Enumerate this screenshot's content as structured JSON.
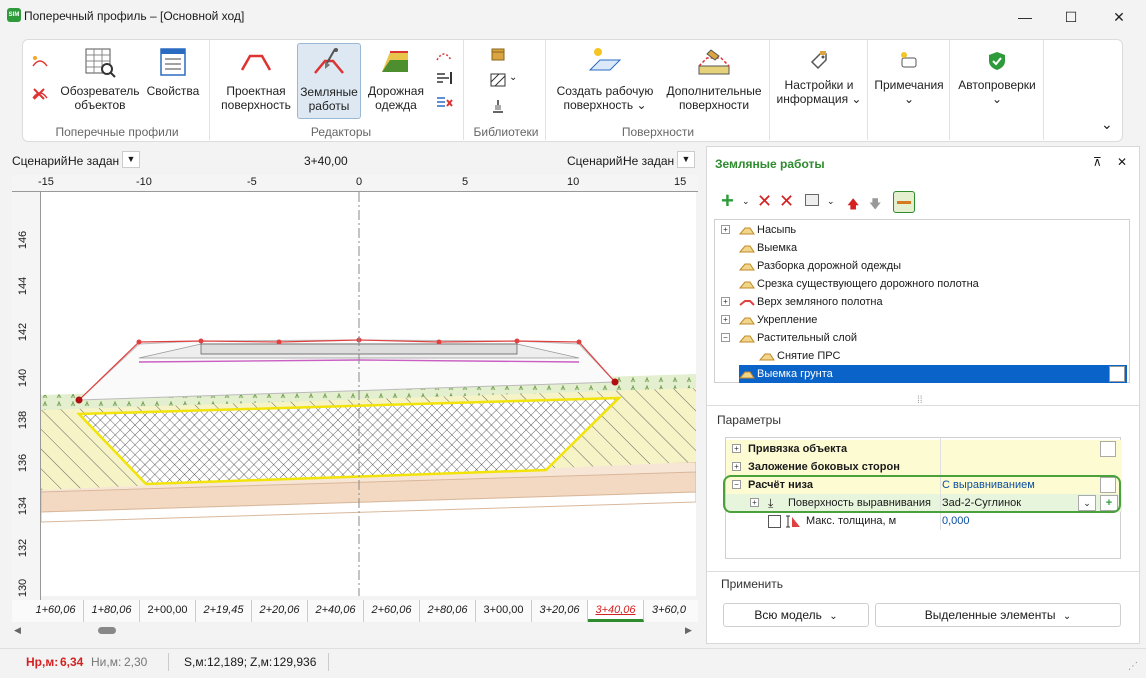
{
  "window": {
    "title": "Поперечный профиль – [Основной ход]",
    "app_icon_text": "SIM",
    "minimize": "—",
    "maximize": "☐",
    "close": "✕"
  },
  "ribbon": {
    "groups": {
      "cross_profiles": "Поперечные профили",
      "editors": "Редакторы",
      "libraries": "Библиотеки",
      "surfaces": "Поверхности"
    },
    "buttons": {
      "browser": "Обозреватель\nобъектов",
      "properties": "Свойства",
      "design_surface": "Проектная\nповерхность",
      "earthworks": "Земляные\nработы",
      "pavement": "Дорожная\nодежда",
      "create_work_surface": "Создать рабочую\nповерхность ⌄",
      "additional_surfaces": "Дополнительные\nповерхности",
      "settings_info": "Настройки и\nинформация ⌄",
      "notes": "Примечания\n⌄",
      "autochecks": "Автопроверки\n⌄"
    },
    "collapse": "⌄"
  },
  "view": {
    "scenario_left_label": "Сценарий:",
    "scenario_left_value": "Не задан",
    "station_center": "3+40,00",
    "scenario_right_label": "Сценарий:",
    "scenario_right_value": "Не задан",
    "x_ticks": [
      "-15",
      "-10",
      "-5",
      "0",
      "5",
      "10",
      "15"
    ],
    "y_ticks": [
      "146",
      "144",
      "142",
      "140",
      "138",
      "136",
      "134",
      "132",
      "130"
    ],
    "stations": [
      "1+60,06",
      "1+80,06",
      "2+00,00",
      "2+19,45",
      "2+20,06",
      "2+40,06",
      "2+60,06",
      "2+80,06",
      "3+00,00",
      "3+20,06",
      "3+40,06",
      "3+60,0"
    ],
    "active_station": "3+40,06"
  },
  "status": {
    "hr_label": "Нр,м:",
    "hr_value": "6,34",
    "hi_label": "Ни,м:",
    "hi_value": "2,30",
    "s_label": "S,м:",
    "s_value": "12,189;",
    "z_label": "Z,м:",
    "z_value": "129,936"
  },
  "panel": {
    "title": "Земляные работы",
    "pin": "⊼",
    "close": "✕",
    "tree": [
      {
        "label": "Насыпь",
        "expander": "+"
      },
      {
        "label": "Выемка",
        "expander": ""
      },
      {
        "label": "Разборка дорожной одежды",
        "expander": ""
      },
      {
        "label": "Срезка существующего дорожного полотна",
        "expander": ""
      },
      {
        "label": "Верх земляного полотна",
        "expander": "+"
      },
      {
        "label": "Укрепление",
        "expander": "+"
      },
      {
        "label": "Растительный слой",
        "expander": "−"
      },
      {
        "label": "Снятие ПРС",
        "expander": ""
      },
      {
        "label": "Выемка грунта",
        "expander": ""
      }
    ],
    "params_title": "Параметры",
    "props": {
      "binding": "Привязка объекта",
      "slopes": "Заложение боковых сторон",
      "bottom_calc": "Расчёт низа",
      "bottom_calc_value": "С выравниванием",
      "level_surface": "Поверхность выравнивания",
      "level_surface_value": "Зad-2-Суглинок",
      "max_thickness": "Макс. толщина, м",
      "max_thickness_value": "0,000"
    },
    "apply_title": "Применить",
    "apply_all": "Всю модель",
    "apply_selected": "Выделенные элементы"
  },
  "colors": {
    "accent_green": "#2e8b2e",
    "selection_blue": "#0a63c8",
    "prop_yellow": "#fdfbd2",
    "red_status": "#d42020"
  }
}
